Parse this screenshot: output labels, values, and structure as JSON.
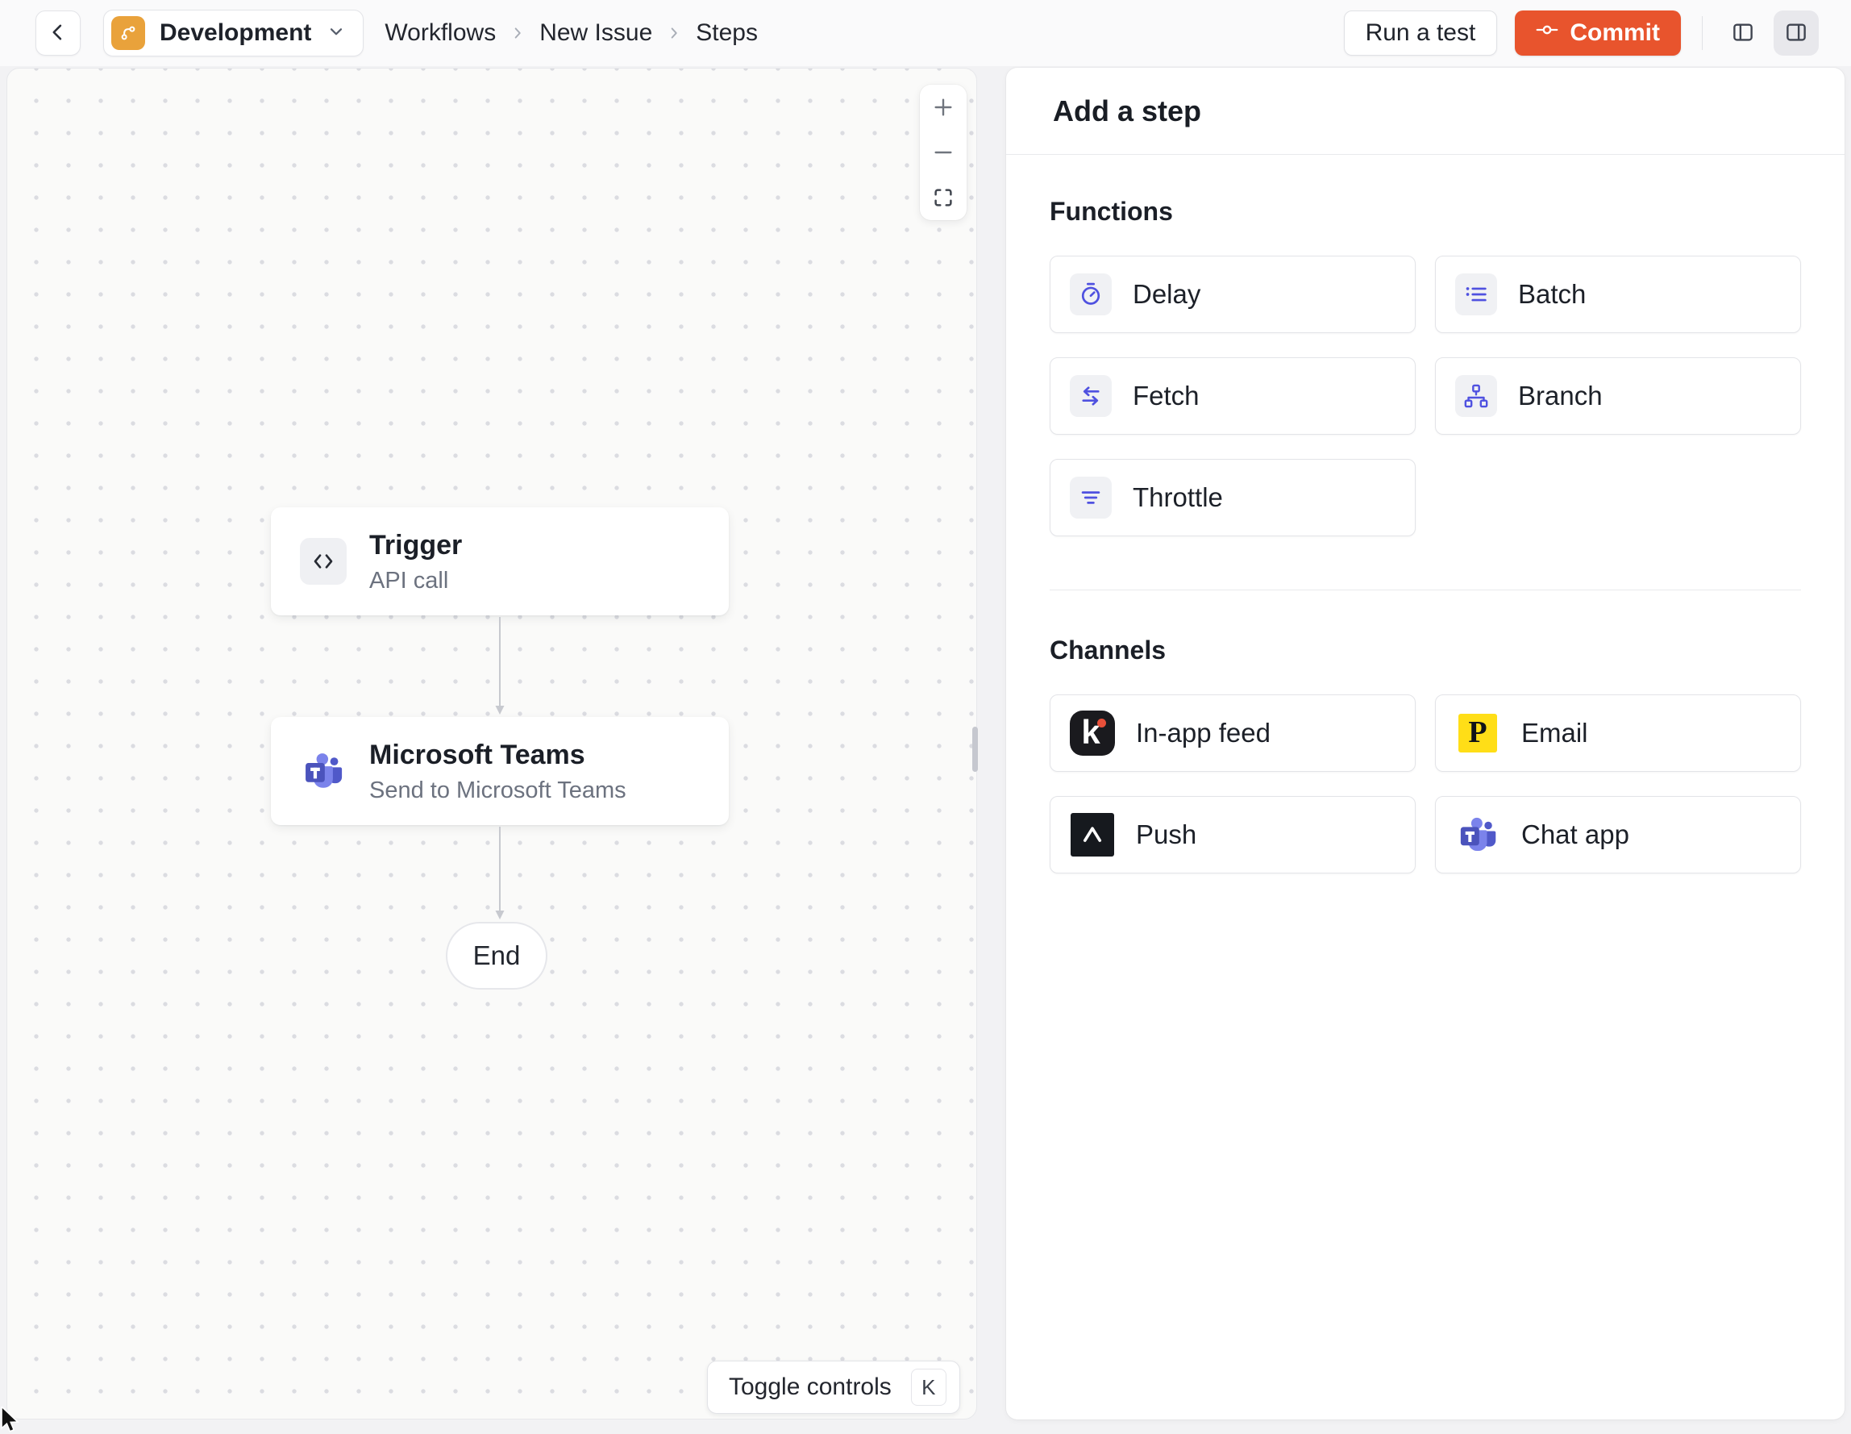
{
  "topbar": {
    "environment": "Development",
    "breadcrumbs": [
      "Workflows",
      "New Issue",
      "Steps"
    ],
    "run_test_label": "Run a test",
    "commit_label": "Commit"
  },
  "canvas": {
    "nodes": {
      "trigger": {
        "title": "Trigger",
        "subtitle": "API call"
      },
      "teams": {
        "title": "Microsoft Teams",
        "subtitle": "Send to Microsoft Teams"
      },
      "end": {
        "label": "End"
      }
    },
    "zoom_controls": [
      "zoom-in",
      "zoom-out",
      "fit-view"
    ],
    "toggle_controls": {
      "label": "Toggle controls",
      "shortcut": "K"
    }
  },
  "panel": {
    "title": "Add a step",
    "functions": {
      "heading": "Functions",
      "items": [
        "Delay",
        "Batch",
        "Fetch",
        "Branch",
        "Throttle"
      ]
    },
    "channels": {
      "heading": "Channels",
      "items": [
        "In-app feed",
        "Email",
        "Push",
        "Chat app"
      ]
    }
  },
  "logos": {
    "knock": "k",
    "postmark": "P"
  },
  "colors": {
    "commit_orange": "#E8542D",
    "environment_amber": "#E9A23B",
    "function_indigo": "#4F51E0",
    "knock_black": "#1A1A1E",
    "knock_dot": "#E8503A",
    "postmark_yellow": "#FFDE17",
    "expo_black": "#16191E",
    "teams_purple_light": "#7B83EB",
    "teams_purple_dark": "#4B53BC",
    "canvas_dot": "#DBDCE1"
  }
}
